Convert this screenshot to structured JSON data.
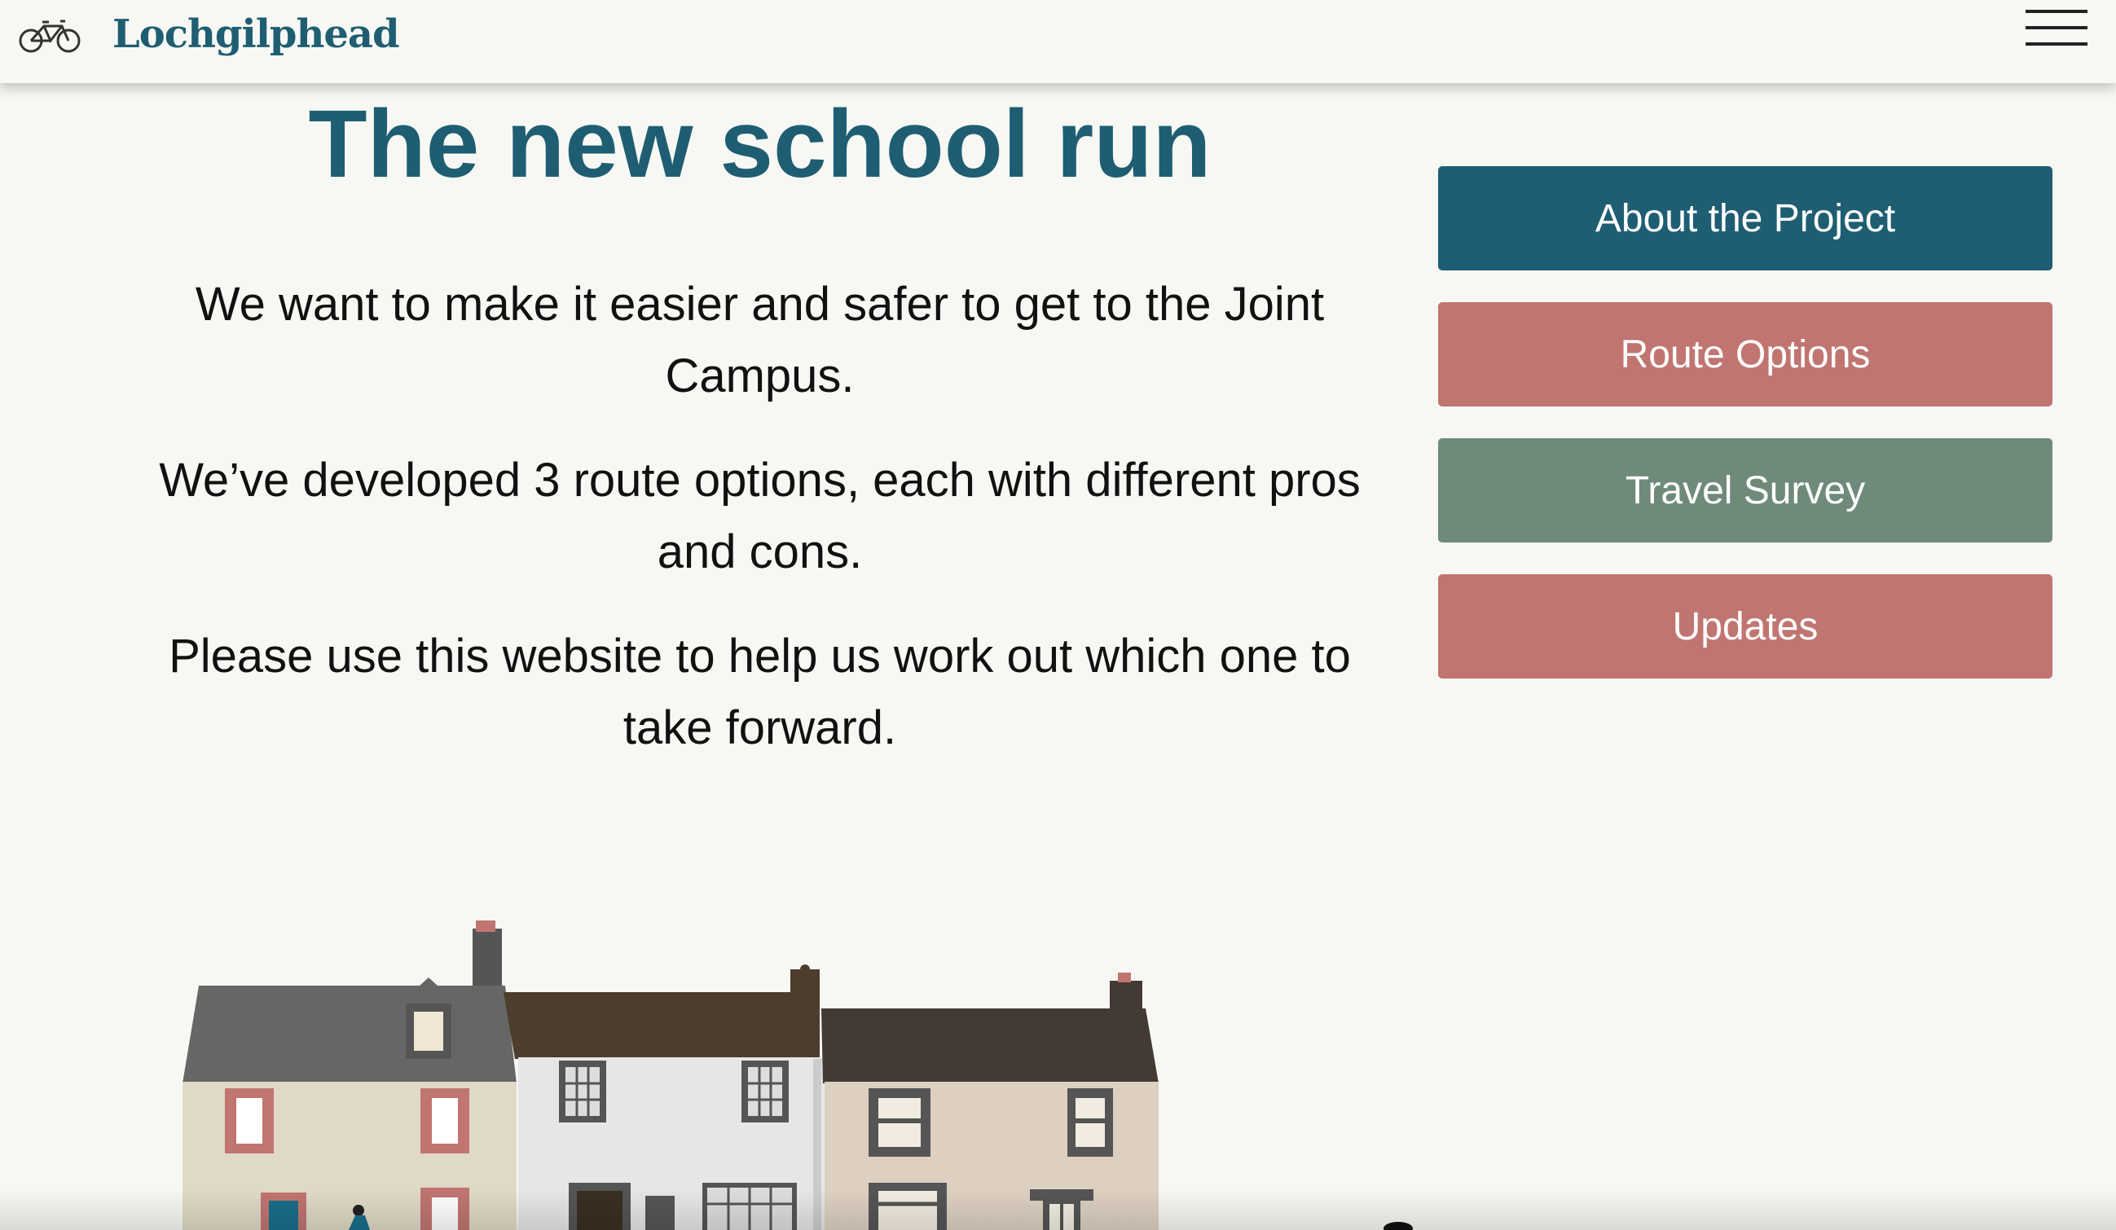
{
  "header": {
    "brand": "Lochgilphead",
    "logo_icon": "bicycle-icon",
    "menu_icon": "hamburger-menu-icon"
  },
  "main": {
    "title": "The new school run",
    "paragraphs": [
      "We want to make it easier and safer to get to the Joint Campus.",
      "We’ve developed 3 route options, each with different pros and cons.",
      "Please use this website to help us work out which one to take forward."
    ]
  },
  "sidebar": {
    "buttons": [
      {
        "label": "About the Project",
        "color": "#1f5e72"
      },
      {
        "label": "Route Options",
        "color": "#c07571"
      },
      {
        "label": "Travel Survey",
        "color": "#6f8a79"
      },
      {
        "label": "Updates",
        "color": "#c07571"
      }
    ]
  },
  "colors": {
    "background": "#f7f8f4",
    "brand": "#1f5e72"
  }
}
